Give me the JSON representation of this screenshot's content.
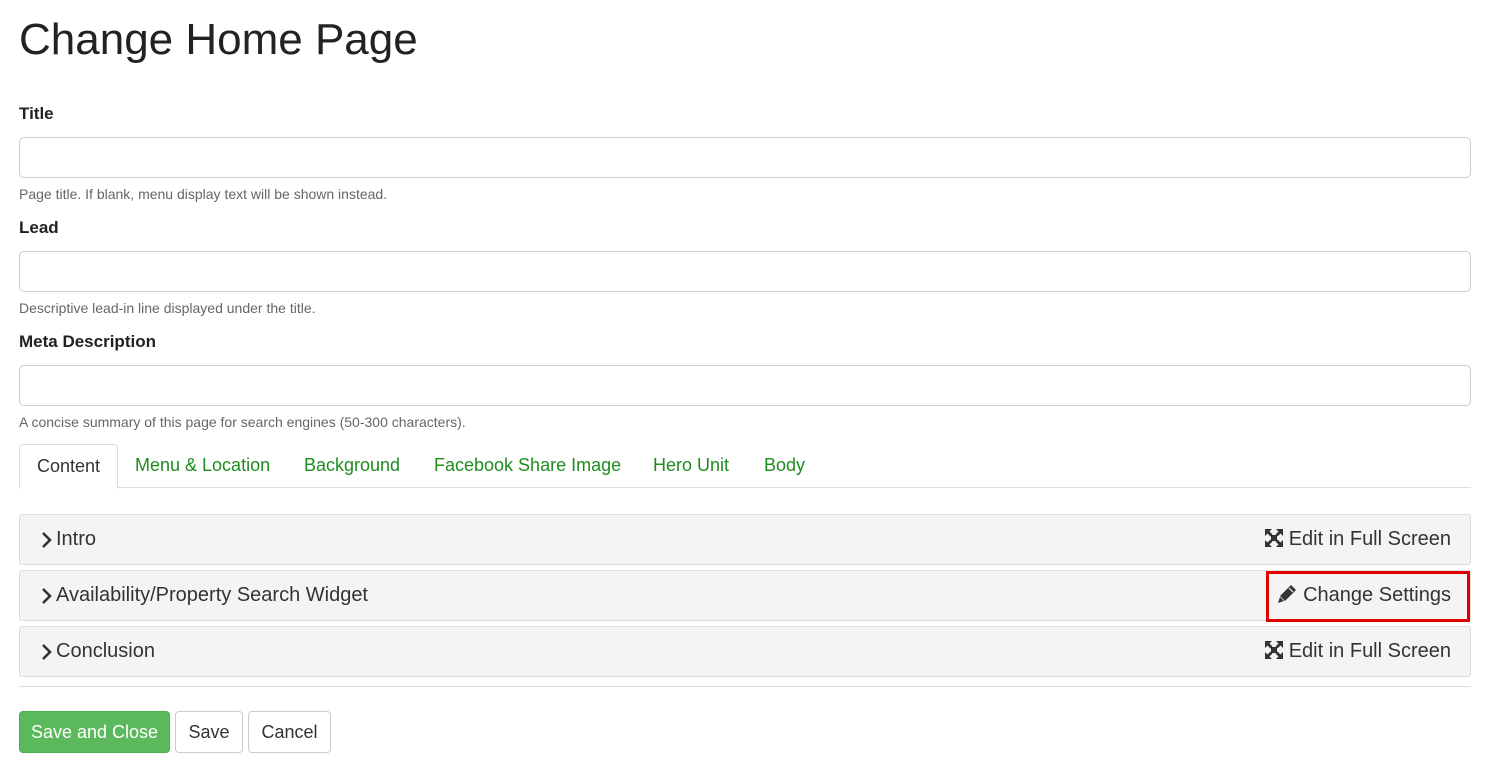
{
  "page": {
    "title": "Change Home Page"
  },
  "fields": {
    "title": {
      "label": "Title",
      "value": "",
      "help": "Page title. If blank, menu display text will be shown instead."
    },
    "lead": {
      "label": "Lead",
      "value": "",
      "help": "Descriptive lead-in line displayed under the title."
    },
    "meta": {
      "label": "Meta Description",
      "value": "",
      "help": "A concise summary of this page for search engines (50-300 characters)."
    }
  },
  "tabs": [
    {
      "label": "Content",
      "active": true
    },
    {
      "label": "Menu & Location"
    },
    {
      "label": "Background"
    },
    {
      "label": "Facebook Share Image"
    },
    {
      "label": "Hero Unit"
    },
    {
      "label": "Body"
    }
  ],
  "panels": [
    {
      "title": "Intro",
      "action": "Edit in Full Screen",
      "action_icon": "expand-icon"
    },
    {
      "title": "Availability/Property Search Widget",
      "action": "Change Settings",
      "action_icon": "pencil-icon",
      "highlighted": true
    },
    {
      "title": "Conclusion",
      "action": "Edit in Full Screen",
      "action_icon": "expand-icon"
    }
  ],
  "buttons": {
    "save_close": "Save and Close",
    "save": "Save",
    "cancel": "Cancel"
  },
  "colors": {
    "link_green": "#1e8c1e",
    "primary_green": "#5cb85c",
    "highlight_red": "#e00000"
  }
}
